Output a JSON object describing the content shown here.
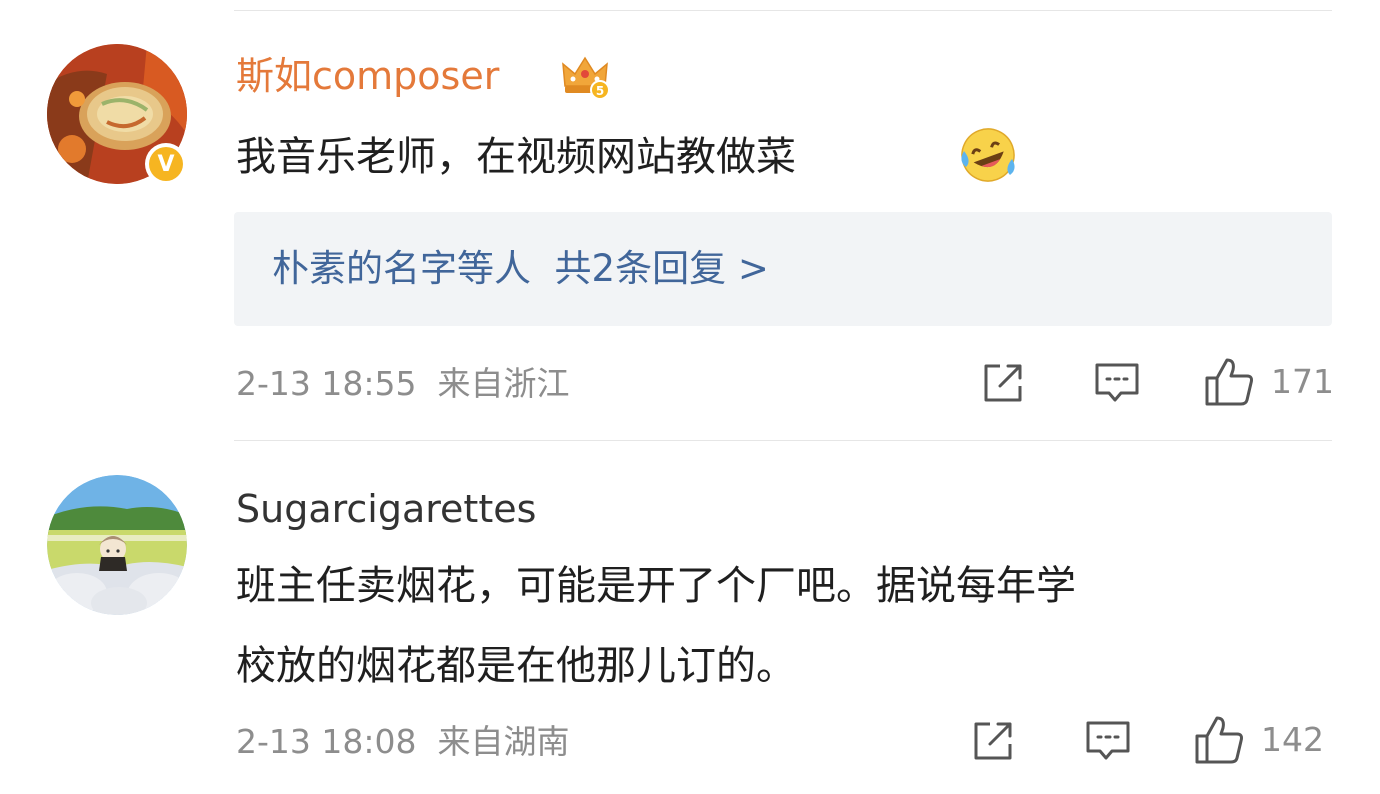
{
  "comments": [
    {
      "username": "斯如composer",
      "verified_badge": "V",
      "badge_icon": "crown-level-icon",
      "badge_level": "5",
      "text": "我音乐老师，在视频网站教做菜",
      "emoji": "laugh-cry-emoji",
      "reply_summary": {
        "names": "朴素的名字等人",
        "count_text": "共2条回复 >"
      },
      "timestamp": "2-13 18:55",
      "location": "来自浙江",
      "likes": "171"
    },
    {
      "username": "Sugarcigarettes",
      "text_line1": "班主任卖烟花，可能是开了个厂吧。据说每年学",
      "text_line2": "校放的烟花都是在他那儿订的。",
      "timestamp": "2-13 18:08",
      "location": "来自湖南",
      "likes": "142"
    }
  ],
  "colors": {
    "vip_name": "#e4793a",
    "link": "#41669a",
    "meta": "#8d8d8d",
    "verified": "#f6b521"
  }
}
